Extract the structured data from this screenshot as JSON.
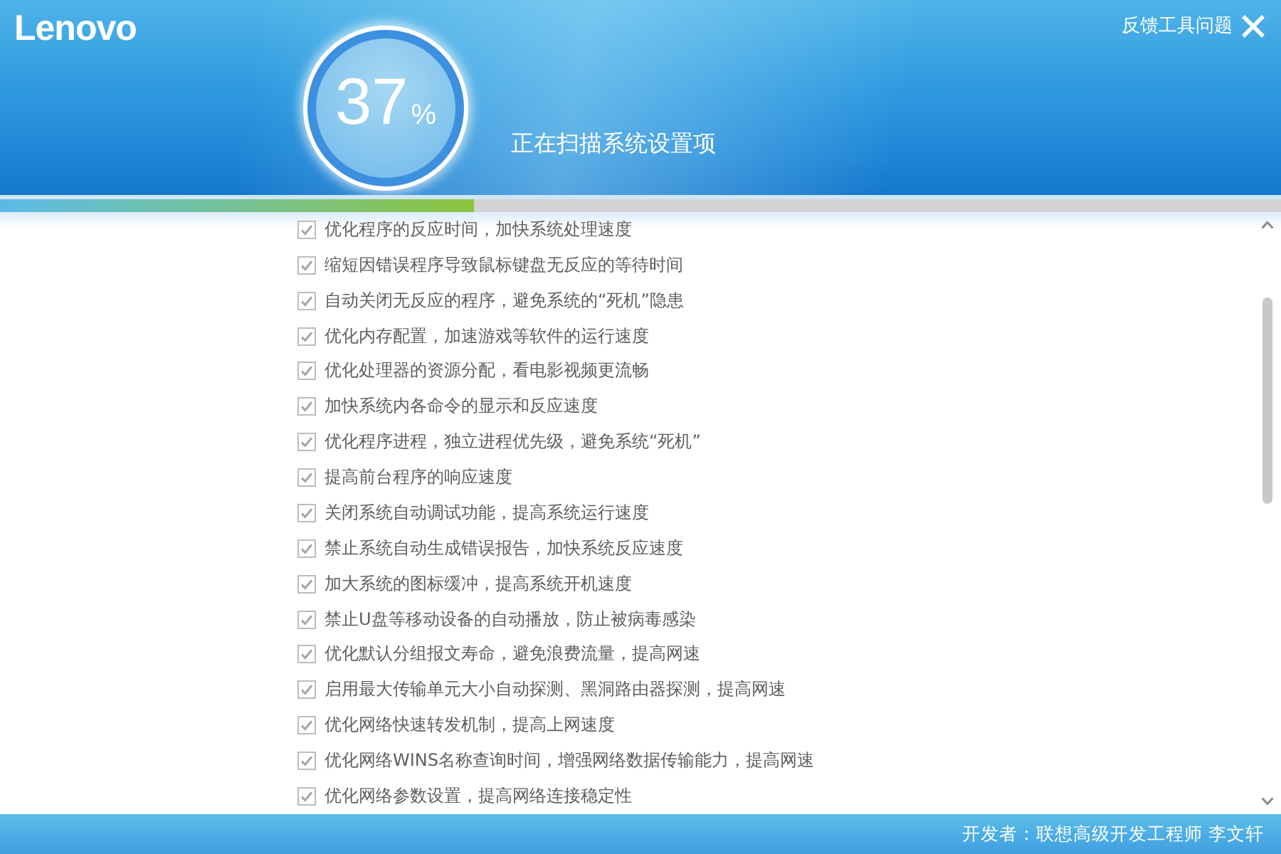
{
  "header": {
    "logo": "Lenovo",
    "feedback_link": "反馈工具问题",
    "progress": {
      "percent": "37",
      "unit": "%"
    },
    "status": "正在扫描系统设置项"
  },
  "progress_bar": {
    "level": 0.37
  },
  "items": [
    {
      "label": "优化程序的反应时间，加快系统处理速度",
      "checked": true
    },
    {
      "label": "缩短因错误程序导致鼠标键盘无反应的等待时间",
      "checked": true
    },
    {
      "label": "自动关闭无反应的程序，避免系统的“死机”隐患",
      "checked": true
    },
    {
      "label": "优化内存配置，加速游戏等软件的运行速度",
      "checked": true
    },
    {
      "label": "优化处理器的资源分配，看电影视频更流畅",
      "checked": true
    },
    {
      "label": "加快系统内各命令的显示和反应速度",
      "checked": true
    },
    {
      "label": "优化程序进程，独立进程优先级，避免系统“死机”",
      "checked": true
    },
    {
      "label": "提高前台程序的响应速度",
      "checked": true
    },
    {
      "label": "关闭系统自动调试功能，提高系统运行速度",
      "checked": true
    },
    {
      "label": "禁止系统自动生成错误报告，加快系统反应速度",
      "checked": true
    },
    {
      "label": "加大系统的图标缓冲，提高系统开机速度",
      "checked": true
    },
    {
      "label": "禁止U盘等移动设备的自动播放，防止被病毒感染",
      "checked": true
    },
    {
      "label": "优化默认分组报文寿命，避免浪费流量，提高网速",
      "checked": true
    },
    {
      "label": "启用最大传输单元大小自动探测、黑洞路由器探测，提高网速",
      "checked": true
    },
    {
      "label": "优化网络快速转发机制，提高上网速度",
      "checked": true
    },
    {
      "label": "优化网络WINS名称查询时间，增强网络数据传输能力，提高网速",
      "checked": true
    },
    {
      "label": "优化网络参数设置，提高网络连接稳定性",
      "checked": true
    }
  ],
  "footer": {
    "credit": "开发者：联想高级开发工程师 李文轩"
  }
}
